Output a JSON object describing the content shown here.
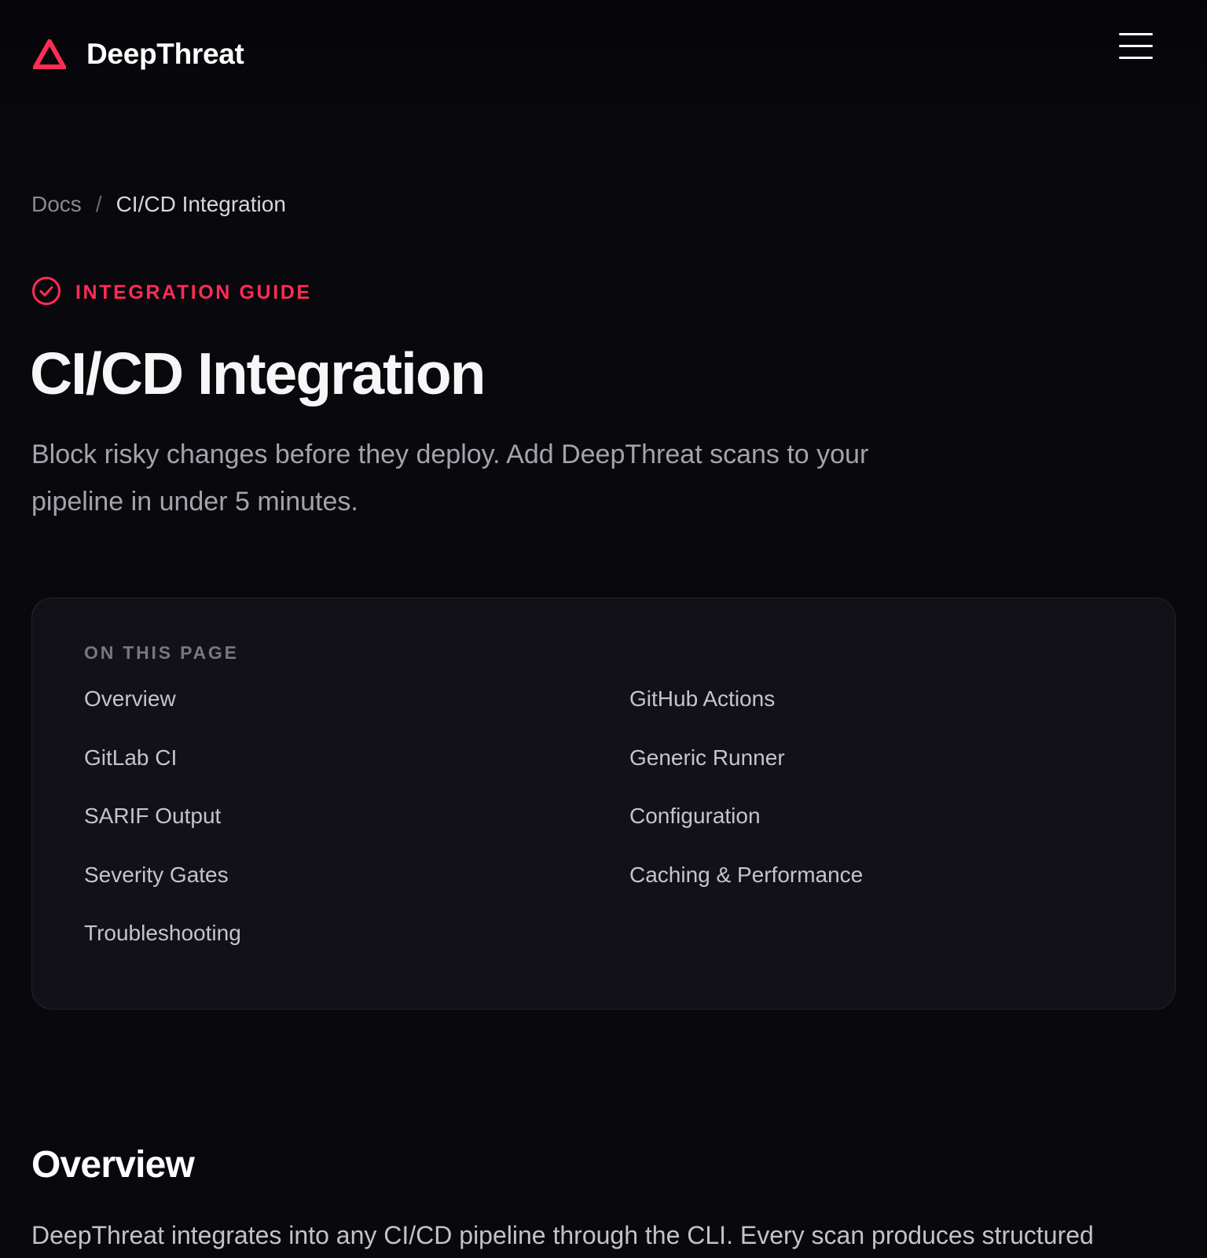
{
  "header": {
    "brand_name": "DeepThreat",
    "logo_icon": "warning-triangle-icon",
    "menu_icon": "hamburger-menu-icon",
    "accent_color": "#ff2d55"
  },
  "breadcrumb": {
    "root": "Docs",
    "separator": "/",
    "current": "CI/CD Integration"
  },
  "eyebrow": {
    "icon": "check-circle-icon",
    "label": "INTEGRATION GUIDE"
  },
  "page": {
    "title": "CI/CD Integration",
    "lead_line1": "Block risky changes before they deploy. Add DeepThreat scans to your",
    "lead_line2": "pipeline in under 5 minutes."
  },
  "toc": {
    "heading": "ON THIS PAGE",
    "links": [
      "Overview",
      "GitHub Actions",
      "GitLab CI",
      "Generic Runner",
      "SARIF Output",
      "Configuration",
      "Severity Gates",
      "Caching & Performance",
      "Troubleshooting"
    ]
  },
  "overview": {
    "title": "Overview",
    "body": "DeepThreat integrates into any CI/CD pipeline through the CLI. Every scan produces structured"
  }
}
